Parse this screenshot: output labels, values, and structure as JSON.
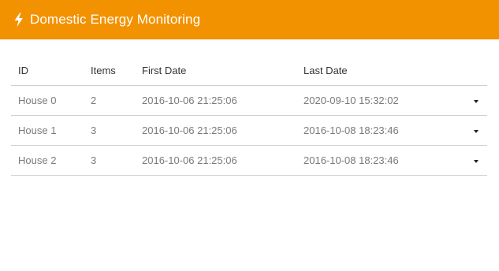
{
  "app": {
    "title": "Domestic Energy Monitoring",
    "icon": "bolt-icon",
    "accent_color": "#f39200"
  },
  "table": {
    "headers": {
      "id": "ID",
      "items": "Items",
      "first_date": "First Date",
      "last_date": "Last Date"
    },
    "rows": [
      {
        "id": "House 0",
        "items": "2",
        "first_date": "2016-10-06 21:25:06",
        "last_date": "2020-09-10 15:32:02",
        "expand_icon": "chevron-down-icon"
      },
      {
        "id": "House 1",
        "items": "3",
        "first_date": "2016-10-06 21:25:06",
        "last_date": "2016-10-08 18:23:46",
        "expand_icon": "chevron-down-icon"
      },
      {
        "id": "House 2",
        "items": "3",
        "first_date": "2016-10-06 21:25:06",
        "last_date": "2016-10-08 18:23:46",
        "expand_icon": "chevron-down-icon"
      }
    ]
  }
}
